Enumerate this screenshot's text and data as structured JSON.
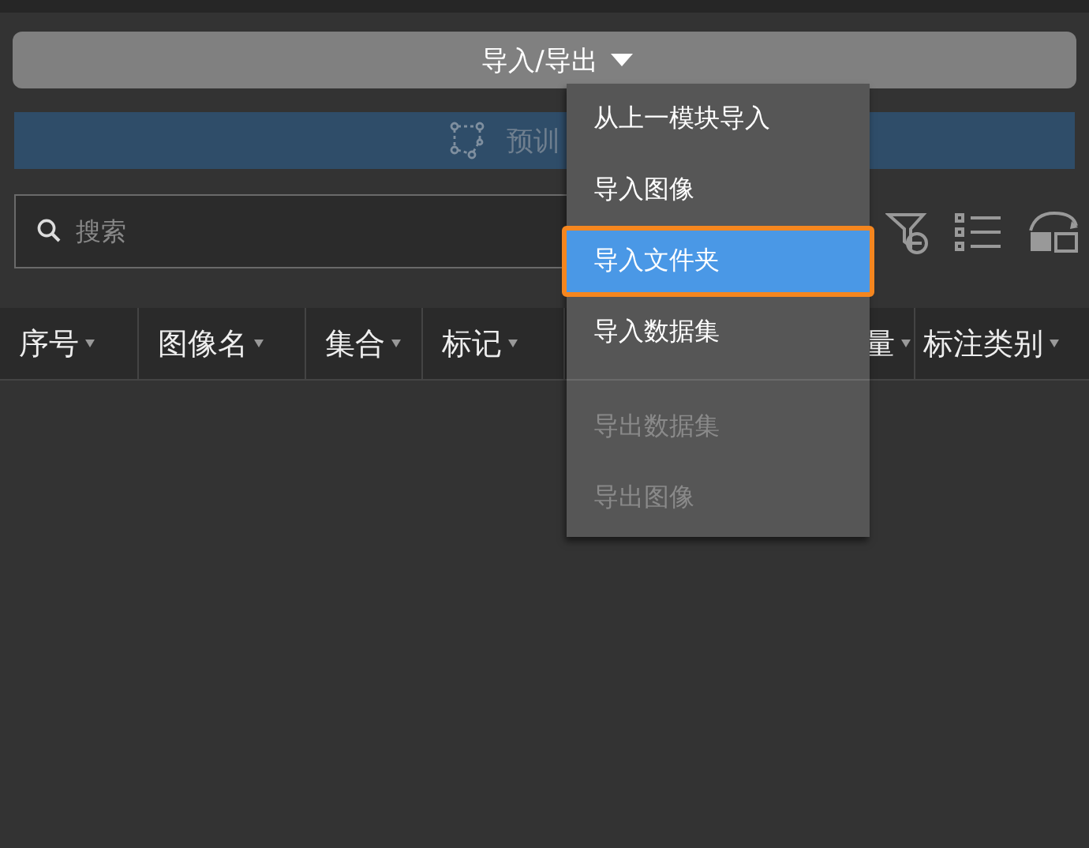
{
  "import_export_button": {
    "label": "导入/导出"
  },
  "pretrain_bar": {
    "label": "预训",
    "disabled": true
  },
  "search": {
    "placeholder": "搜索"
  },
  "table": {
    "columns": [
      {
        "label": "序号"
      },
      {
        "label": "图像名"
      },
      {
        "label": "集合"
      },
      {
        "label": "标记"
      },
      {
        "label": "量"
      },
      {
        "label": "标注类别"
      }
    ]
  },
  "menu": {
    "groups": [
      [
        {
          "label": "从上一模块导入",
          "selected": false,
          "disabled": false
        },
        {
          "label": "导入图像",
          "selected": false,
          "disabled": false
        },
        {
          "label": "导入文件夹",
          "selected": true,
          "disabled": false
        },
        {
          "label": "导入数据集",
          "selected": false,
          "disabled": false
        }
      ],
      [
        {
          "label": "导出数据集",
          "selected": false,
          "disabled": true
        },
        {
          "label": "导出图像",
          "selected": false,
          "disabled": true
        }
      ]
    ]
  }
}
